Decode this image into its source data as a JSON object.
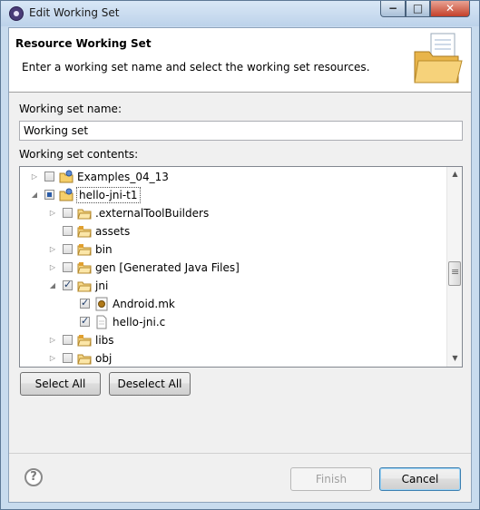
{
  "window": {
    "title": "Edit Working Set",
    "controls": {
      "minimize": "−",
      "maximize": "□",
      "close": "✕"
    }
  },
  "banner": {
    "title": "Resource Working Set",
    "description": "Enter a working set name and select the working set resources.",
    "icon": "folder-icon"
  },
  "form": {
    "name_label": "Working set name:",
    "name_value": "Working set",
    "contents_label": "Working set contents:"
  },
  "tree": {
    "items": [
      {
        "label": "Examples_04_13",
        "level": 0,
        "expand": "collapsed",
        "check": "unchecked",
        "icon": "project-icon"
      },
      {
        "label": "hello-jni-t1",
        "level": 0,
        "expand": "expanded",
        "check": "partial",
        "icon": "project-icon",
        "focused": true
      },
      {
        "label": ".externalToolBuilders",
        "level": 1,
        "expand": "collapsed",
        "check": "unchecked",
        "icon": "folder-icon"
      },
      {
        "label": "assets",
        "level": 1,
        "expand": "none",
        "check": "unchecked",
        "icon": "source-folder-icon"
      },
      {
        "label": "bin",
        "level": 1,
        "expand": "collapsed",
        "check": "unchecked",
        "icon": "source-folder-icon"
      },
      {
        "label": "gen [Generated Java Files]",
        "level": 1,
        "expand": "collapsed",
        "check": "unchecked",
        "icon": "source-folder-icon"
      },
      {
        "label": "jni",
        "level": 1,
        "expand": "expanded",
        "check": "checked",
        "icon": "folder-icon"
      },
      {
        "label": "Android.mk",
        "level": 2,
        "expand": "none",
        "check": "checked",
        "icon": "makefile-icon"
      },
      {
        "label": "hello-jni.c",
        "level": 2,
        "expand": "none",
        "check": "checked",
        "icon": "file-icon"
      },
      {
        "label": "libs",
        "level": 1,
        "expand": "collapsed",
        "check": "unchecked",
        "icon": "source-folder-icon"
      },
      {
        "label": "obj",
        "level": 1,
        "expand": "collapsed",
        "check": "unchecked",
        "icon": "folder-icon"
      }
    ]
  },
  "buttons": {
    "select_all": "Select All",
    "deselect_all": "Deselect All",
    "finish": "Finish",
    "cancel": "Cancel",
    "help": "?"
  },
  "colors": {
    "frame": "#c8dbee",
    "folder": "#f2c14e",
    "check": "#1e3c6a"
  }
}
